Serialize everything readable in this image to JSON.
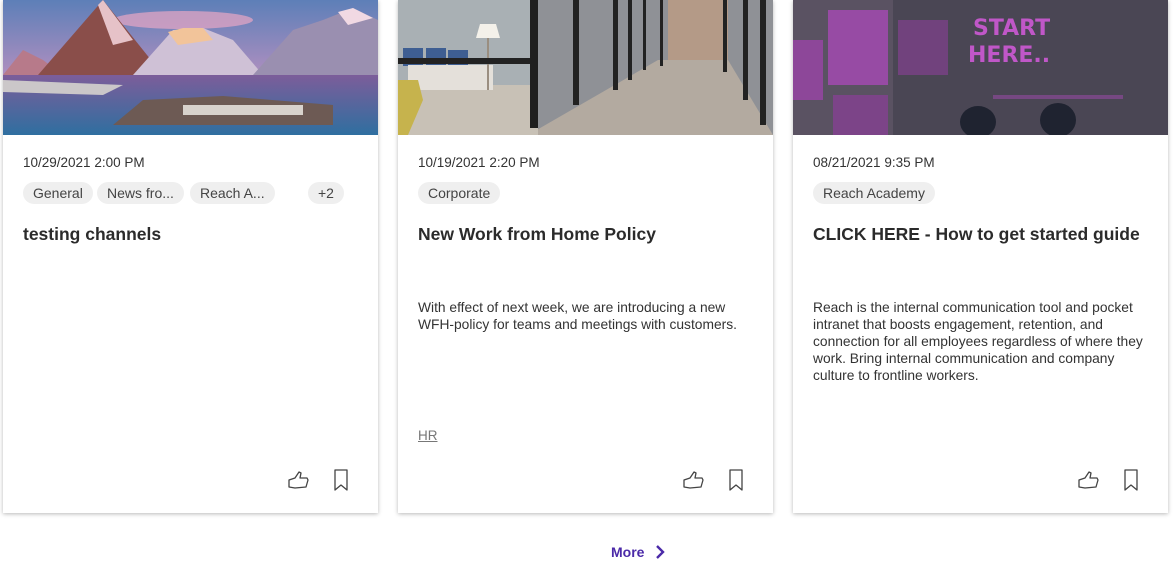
{
  "cards": [
    {
      "image": "mountain-lake-village",
      "date": "10/29/2021 2:00 PM",
      "chips": [
        "General",
        "News fro...",
        "Reach A..."
      ],
      "more_chips": "+2",
      "title": "testing channels",
      "body": "",
      "link_tag": ""
    },
    {
      "image": "office-glass-corridor",
      "date": "10/19/2021 2:20 PM",
      "chips": [
        "Corporate"
      ],
      "title": "New Work from Home Policy",
      "body": "With effect of next week, we are introducing a new WFH-policy for teams and meetings with customers.",
      "link_tag": "HR"
    },
    {
      "image": "start-here-pavement",
      "date": "08/21/2021 9:35 PM",
      "chips": [
        "Reach Academy"
      ],
      "title": "CLICK HERE - How to get started guide",
      "body": "Reach is the internal communication tool and pocket intranet that boosts engagement, retention, and connection for all employees regardless of where they work. Bring internal communication and company culture to frontline workers.",
      "link_tag": ""
    }
  ],
  "actions": {
    "like_icon": "thumbs-up-icon",
    "bookmark_icon": "bookmark-icon"
  },
  "more": {
    "label": "More",
    "icon": "chevron-right-icon"
  },
  "colors": {
    "accent": "#4b2aa8",
    "chip_bg": "#efefef",
    "text": "#333333"
  }
}
